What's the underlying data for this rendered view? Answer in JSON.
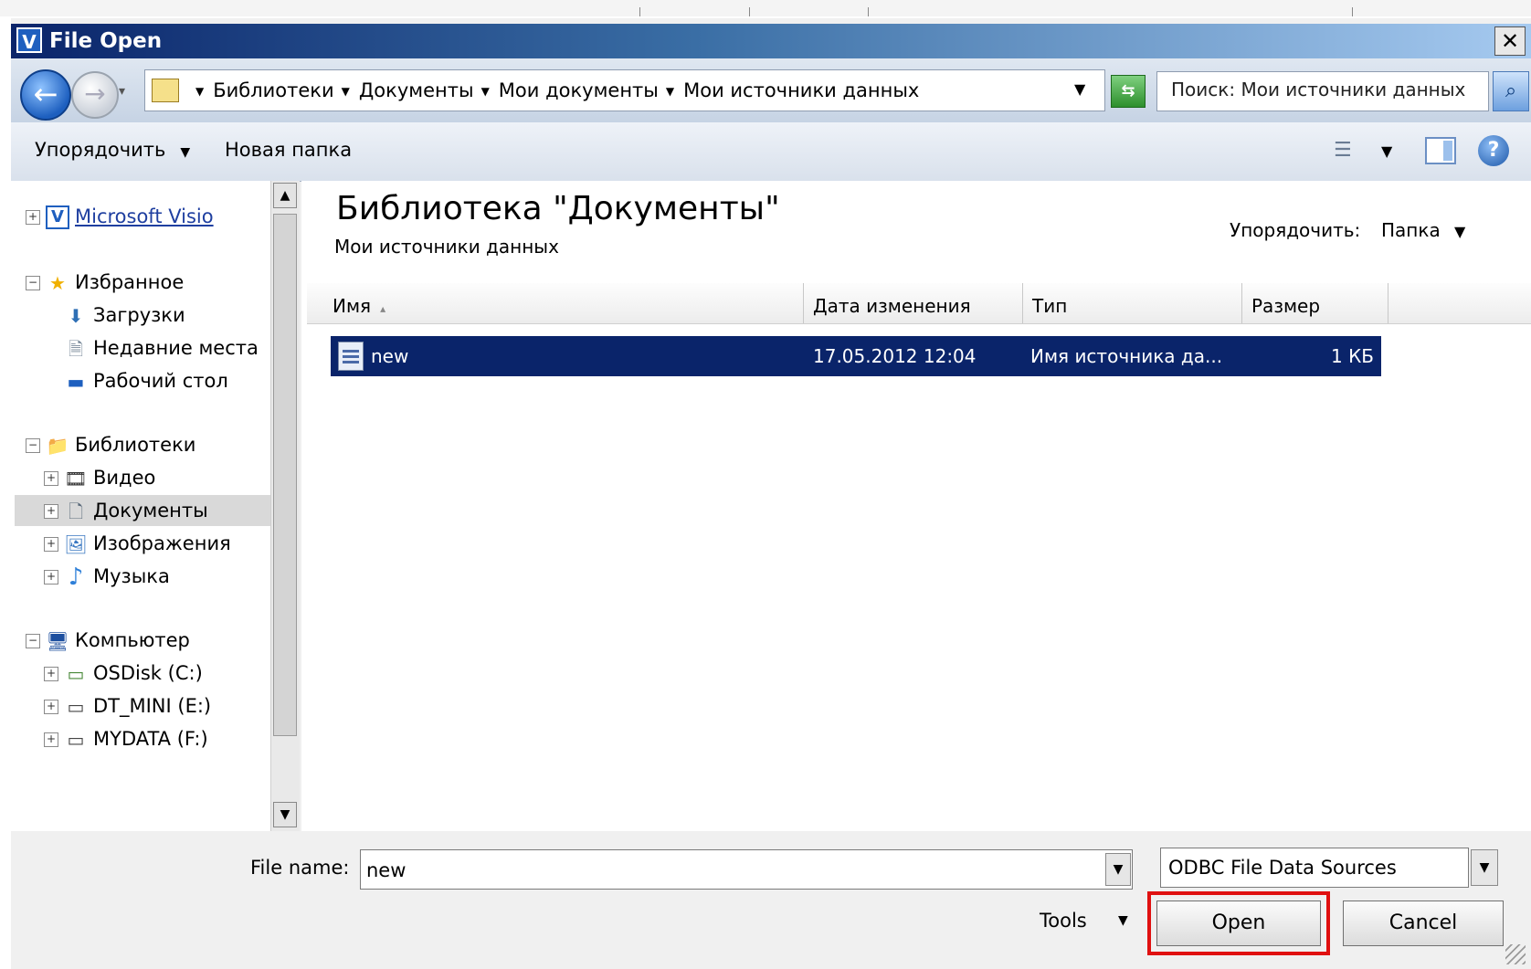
{
  "window": {
    "title": "File Open",
    "title_icon": "V",
    "close_glyph": "✕"
  },
  "address_bar": {
    "breadcrumbs": [
      "Библиотеки",
      "Документы",
      "Мои документы",
      "Мои источники данных"
    ],
    "search_placeholder": "Поиск: Мои источники данных"
  },
  "command_bar": {
    "organize_label": "Упорядочить",
    "new_folder_label": "Новая папка"
  },
  "nav_tree": {
    "items": [
      {
        "label": "Microsoft Visio",
        "icon": "visio-icon",
        "glyph": "V",
        "expander": "+",
        "link": true
      },
      {
        "label": "Избранное",
        "icon": "star-icon",
        "glyph": "★",
        "expander": "−"
      },
      {
        "label": "Загрузки",
        "icon": "downloads-icon",
        "glyph": "⬇"
      },
      {
        "label": "Недавние места",
        "icon": "recent-places-icon",
        "glyph": "🗎"
      },
      {
        "label": "Рабочий стол",
        "icon": "desktop-icon",
        "glyph": "▬"
      },
      {
        "label": "Библиотеки",
        "icon": "libraries-icon",
        "glyph": "📁",
        "expander": "−"
      },
      {
        "label": "Видео",
        "icon": "video-icon",
        "glyph": "🎞",
        "expander": "+"
      },
      {
        "label": "Документы",
        "icon": "documents-icon",
        "glyph": "🗋",
        "expander": "+",
        "selected": true
      },
      {
        "label": "Изображения",
        "icon": "pictures-icon",
        "glyph": "🖼",
        "expander": "+"
      },
      {
        "label": "Музыка",
        "icon": "music-icon",
        "glyph": "♪",
        "expander": "+"
      },
      {
        "label": "Компьютер",
        "icon": "computer-icon",
        "glyph": "🖥",
        "expander": "−"
      },
      {
        "label": "OSDisk (C:)",
        "icon": "drive-c-icon",
        "glyph": "▭",
        "expander": "+"
      },
      {
        "label": "DT_MINI (E:)",
        "icon": "drive-e-icon",
        "glyph": "▭",
        "expander": "+"
      },
      {
        "label": "MYDATA (F:)",
        "icon": "drive-f-icon",
        "glyph": "▭",
        "expander": "+"
      }
    ]
  },
  "content": {
    "library_title": "Библиотека \"Документы\"",
    "library_subtitle": "Мои источники данных",
    "arrange_label": "Упорядочить:",
    "arrange_value": "Папка",
    "columns": [
      "Имя",
      "Дата изменения",
      "Тип",
      "Размер"
    ],
    "sort_indicator": "▴",
    "files": [
      {
        "name": "new",
        "modified": "17.05.2012 12:04",
        "type": "Имя источника да...",
        "size": "1 КБ",
        "selected": true
      }
    ]
  },
  "footer": {
    "file_name_label": "File name:",
    "file_name_value": "new",
    "file_type_value": "ODBC File Data Sources",
    "tools_label": "Tools",
    "open_label": "Open",
    "cancel_label": "Cancel"
  },
  "colors": {
    "selection": "#0a246a",
    "highlight_border": "#e01010",
    "title_gradient_start": "#0a246a"
  }
}
